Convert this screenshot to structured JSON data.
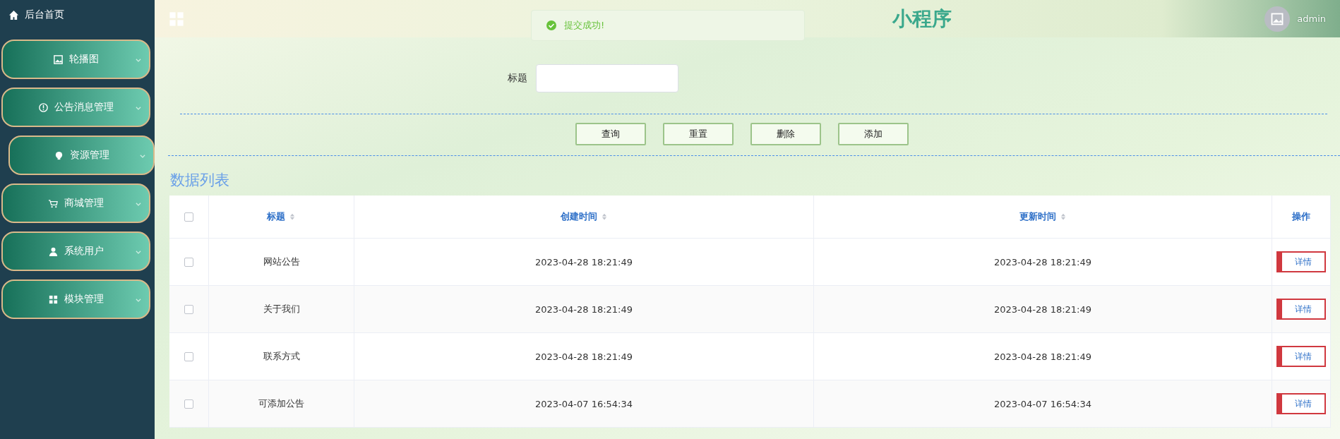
{
  "sidebar": {
    "home": "后台首页",
    "items": [
      {
        "label": "轮播图",
        "hovered": false
      },
      {
        "label": "公告消息管理",
        "hovered": false
      },
      {
        "label": "资源管理",
        "hovered": true
      },
      {
        "label": "商城管理",
        "hovered": false
      },
      {
        "label": "系统用户",
        "hovered": false
      },
      {
        "label": "模块管理",
        "hovered": false
      }
    ]
  },
  "header": {
    "title": "小程序",
    "user": "admin"
  },
  "toast": {
    "message": "提交成功!"
  },
  "search": {
    "label": "标题"
  },
  "buttons": [
    "查询",
    "重置",
    "删除",
    "添加"
  ],
  "list_title": "数据列表",
  "table": {
    "select_all": {
      "checked": false
    },
    "columns": [
      {
        "label": "标题",
        "sortable": true
      },
      {
        "label": "创建时间",
        "sortable": true
      },
      {
        "label": "更新时间",
        "sortable": true
      },
      {
        "label": "操作",
        "sortable": false
      }
    ],
    "rows": [
      {
        "checked": false,
        "cells": [
          "网站公告",
          "2023-04-28 18:21:49",
          "2023-04-28 18:21:49"
        ],
        "action": "详情"
      },
      {
        "checked": false,
        "cells": [
          "关于我们",
          "2023-04-28 18:21:49",
          "2023-04-28 18:21:49"
        ],
        "action": "详情"
      },
      {
        "checked": false,
        "cells": [
          "联系方式",
          "2023-04-28 18:21:49",
          "2023-04-28 18:21:49"
        ],
        "action": "详情"
      },
      {
        "checked": false,
        "cells": [
          "可添加公告",
          "2023-04-07 16:54:34",
          "2023-04-07 16:54:34"
        ],
        "action": "详情"
      }
    ]
  }
}
